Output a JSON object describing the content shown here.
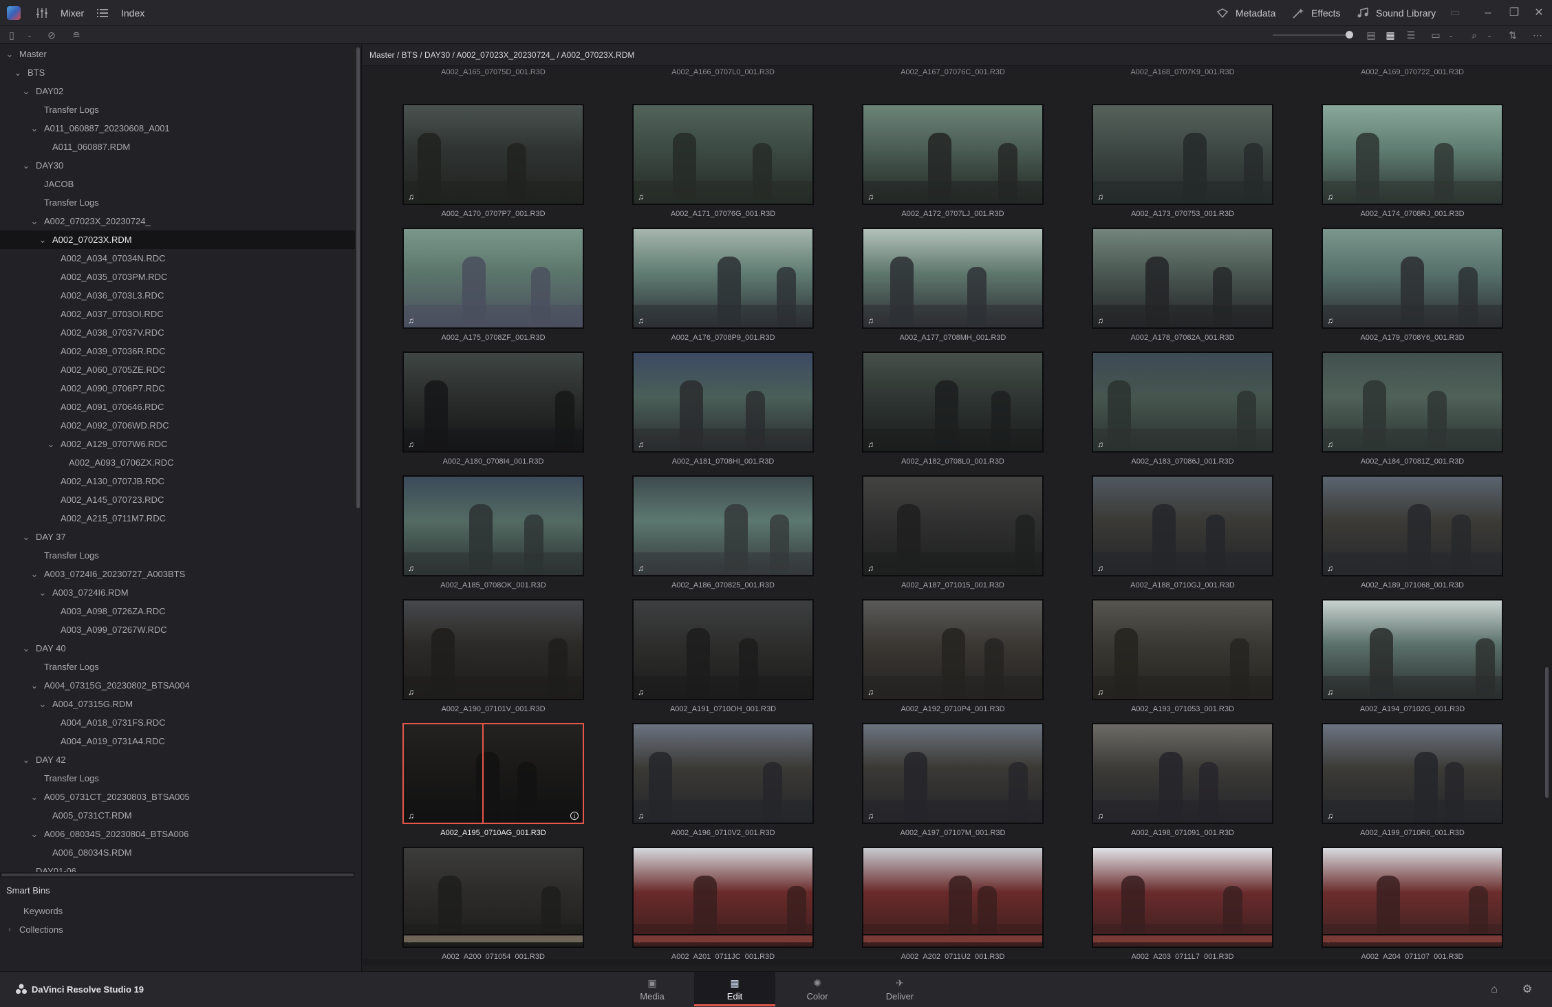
{
  "app": {
    "top_items": [
      {
        "icon": "mixer-icon",
        "label": "Mixer"
      },
      {
        "icon": "index-icon",
        "label": "Index"
      }
    ],
    "right_items": [
      {
        "icon": "metadata-icon",
        "label": "Metadata"
      },
      {
        "icon": "effects-icon",
        "label": "Effects"
      },
      {
        "icon": "sound-library-icon",
        "label": "Sound Library"
      }
    ]
  },
  "breadcrumb": "Master / BTS / DAY30 / A002_07023X_20230724_ / A002_07023X.RDM",
  "tree": [
    {
      "label": "Master",
      "depth": 0,
      "chev": "v"
    },
    {
      "label": "BTS",
      "depth": 1,
      "chev": "v"
    },
    {
      "label": "DAY02",
      "depth": 2,
      "chev": "v"
    },
    {
      "label": "Transfer Logs",
      "depth": 3,
      "chev": ""
    },
    {
      "label": "A011_060887_20230608_A001",
      "depth": 3,
      "chev": "v"
    },
    {
      "label": "A011_060887.RDM",
      "depth": 4,
      "chev": ""
    },
    {
      "label": "DAY30",
      "depth": 2,
      "chev": "v"
    },
    {
      "label": "JACOB",
      "depth": 3,
      "chev": ""
    },
    {
      "label": "Transfer Logs",
      "depth": 3,
      "chev": ""
    },
    {
      "label": "A002_07023X_20230724_",
      "depth": 3,
      "chev": "v"
    },
    {
      "label": "A002_07023X.RDM",
      "depth": 4,
      "chev": "v",
      "selected": true
    },
    {
      "label": "A002_A034_07034N.RDC",
      "depth": 5,
      "chev": ""
    },
    {
      "label": "A002_A035_0703PM.RDC",
      "depth": 5,
      "chev": ""
    },
    {
      "label": "A002_A036_0703L3.RDC",
      "depth": 5,
      "chev": ""
    },
    {
      "label": "A002_A037_0703OI.RDC",
      "depth": 5,
      "chev": ""
    },
    {
      "label": "A002_A038_07037V.RDC",
      "depth": 5,
      "chev": ""
    },
    {
      "label": "A002_A039_07036R.RDC",
      "depth": 5,
      "chev": ""
    },
    {
      "label": "A002_A060_0705ZE.RDC",
      "depth": 5,
      "chev": ""
    },
    {
      "label": "A002_A090_0706P7.RDC",
      "depth": 5,
      "chev": ""
    },
    {
      "label": "A002_A091_070646.RDC",
      "depth": 5,
      "chev": ""
    },
    {
      "label": "A002_A092_0706WD.RDC",
      "depth": 5,
      "chev": ""
    },
    {
      "label": "A002_A129_0707W6.RDC",
      "depth": 5,
      "chev": "v"
    },
    {
      "label": "A002_A093_0706ZX.RDC",
      "depth": 6,
      "chev": ""
    },
    {
      "label": "A002_A130_0707JB.RDC",
      "depth": 5,
      "chev": ""
    },
    {
      "label": "A002_A145_070723.RDC",
      "depth": 5,
      "chev": ""
    },
    {
      "label": "A002_A215_0711M7.RDC",
      "depth": 5,
      "chev": ""
    },
    {
      "label": "DAY 37",
      "depth": 2,
      "chev": "v"
    },
    {
      "label": "Transfer Logs",
      "depth": 3,
      "chev": ""
    },
    {
      "label": "A003_0724I6_20230727_A003BTS",
      "depth": 3,
      "chev": "v"
    },
    {
      "label": "A003_0724I6.RDM",
      "depth": 4,
      "chev": "v"
    },
    {
      "label": "A003_A098_0726ZA.RDC",
      "depth": 5,
      "chev": ""
    },
    {
      "label": "A003_A099_07267W.RDC",
      "depth": 5,
      "chev": ""
    },
    {
      "label": "DAY 40",
      "depth": 2,
      "chev": "v"
    },
    {
      "label": "Transfer Logs",
      "depth": 3,
      "chev": ""
    },
    {
      "label": "A004_07315G_20230802_BTSA004",
      "depth": 3,
      "chev": "v"
    },
    {
      "label": "A004_07315G.RDM",
      "depth": 4,
      "chev": "v"
    },
    {
      "label": "A004_A018_0731FS.RDC",
      "depth": 5,
      "chev": ""
    },
    {
      "label": "A004_A019_0731A4.RDC",
      "depth": 5,
      "chev": ""
    },
    {
      "label": "DAY 42",
      "depth": 2,
      "chev": "v"
    },
    {
      "label": "Transfer Logs",
      "depth": 3,
      "chev": ""
    },
    {
      "label": "A005_0731CT_20230803_BTSA005",
      "depth": 3,
      "chev": "v"
    },
    {
      "label": "A005_0731CT.RDM",
      "depth": 4,
      "chev": ""
    },
    {
      "label": "A006_08034S_20230804_BTSA006",
      "depth": 3,
      "chev": "v"
    },
    {
      "label": "A006_08034S.RDM",
      "depth": 4,
      "chev": ""
    },
    {
      "label": "DAY01-06",
      "depth": 2,
      "chev": "v"
    }
  ],
  "smart_bins": {
    "title": "Smart Bins",
    "items": [
      {
        "label": "Keywords",
        "chev": ""
      },
      {
        "label": "Collections",
        "chev": ">"
      }
    ]
  },
  "top_row_labels": [
    "A002_A165_07075D_001.R3D",
    "A002_A166_0707L0_001.R3D",
    "A002_A167_07076C_001.R3D",
    "A002_A168_0707K9_001.R3D",
    "A002_A169_070722_001.R3D"
  ],
  "clips": [
    {
      "name": "A002_A170_0707P7_001.R3D",
      "colors": [
        "#2f3432",
        "#4a5250",
        "#20221f"
      ]
    },
    {
      "name": "A002_A171_07076G_001.R3D",
      "colors": [
        "#3b4a42",
        "#51635a",
        "#262b27"
      ]
    },
    {
      "name": "A002_A172_0707LJ_001.R3D",
      "colors": [
        "#4a5c54",
        "#6c8478",
        "#232624"
      ]
    },
    {
      "name": "A002_A173_070753_001.R3D",
      "colors": [
        "#3d4743",
        "#56615c",
        "#25292a"
      ]
    },
    {
      "name": "A002_A174_0708RJ_001.R3D",
      "colors": [
        "#5f7d72",
        "#8aa79b",
        "#2e3532"
      ]
    },
    {
      "name": "A002_A175_0708ZF_001.R3D",
      "colors": [
        "#5b756b",
        "#7b978b",
        "#4a4f5e"
      ]
    },
    {
      "name": "A002_A176_0708P9_001.R3D",
      "colors": [
        "#607c72",
        "#a5b6ad",
        "#2c3034"
      ]
    },
    {
      "name": "A002_A177_0708MH_001.R3D",
      "colors": [
        "#5e776d",
        "#b3c2ba",
        "#2d3034"
      ]
    },
    {
      "name": "A002_A178_07082A_001.R3D",
      "colors": [
        "#4a5752",
        "#73857c",
        "#232527"
      ]
    },
    {
      "name": "A002_A179_0708Y6_001.R3D",
      "colors": [
        "#56706a",
        "#7b978d",
        "#2b2e31"
      ]
    },
    {
      "name": "A002_A180_0708I4_001.R3D",
      "colors": [
        "#2a2d2c",
        "#3f4644",
        "#151617"
      ]
    },
    {
      "name": "A002_A181_0708HI_001.R3D",
      "colors": [
        "#4a5f58",
        "#3c4962",
        "#2a2c2e"
      ]
    },
    {
      "name": "A002_A182_0708L0_001.R3D",
      "colors": [
        "#2e3532",
        "#46504b",
        "#1c1e1e"
      ]
    },
    {
      "name": "A002_A183_07086J_001.R3D",
      "colors": [
        "#46564f",
        "#3d4a55",
        "#2c3230"
      ]
    },
    {
      "name": "A002_A184_07081Z_001.R3D",
      "colors": [
        "#4f6159",
        "#42504e",
        "#2e3533"
      ]
    },
    {
      "name": "A002_A185_0708OK_001.R3D",
      "colors": [
        "#536b63",
        "#3b4a5a",
        "#2d3333"
      ]
    },
    {
      "name": "A002_A186_070825_001.R3D",
      "colors": [
        "#5c7870",
        "#3e4a4e",
        "#34393a"
      ]
    },
    {
      "name": "A002_A187_071015_001.R3D",
      "colors": [
        "#2f302f",
        "#434442",
        "#1e1f1f"
      ]
    },
    {
      "name": "A002_A188_0710GJ_001.R3D",
      "colors": [
        "#3a3935",
        "#505860",
        "#24262a"
      ]
    },
    {
      "name": "A002_A189_071068_001.R3D",
      "colors": [
        "#3b3a36",
        "#5a6470",
        "#26282b"
      ]
    },
    {
      "name": "A002_A190_07101V_001.R3D",
      "colors": [
        "#2c2a27",
        "#46484c",
        "#1e1d1c"
      ]
    },
    {
      "name": "A002_A191_0710OH_001.R3D",
      "colors": [
        "#2d2d2c",
        "#3d3f40",
        "#1c1c1c"
      ]
    },
    {
      "name": "A002_A192_0710P4_001.R3D",
      "colors": [
        "#3a3733",
        "#5a5a58",
        "#242320"
      ]
    },
    {
      "name": "A002_A193_071053_001.R3D",
      "colors": [
        "#3a3833",
        "#565550",
        "#24231f"
      ]
    },
    {
      "name": "A002_A194_07102G_001.R3D",
      "colors": [
        "#5a706a",
        "#c9d3d0",
        "#2a2e2d"
      ]
    },
    {
      "name": "A002_A195_0710AG_001.R3D",
      "colors": [
        "#1a1918",
        "#232221",
        "#121212"
      ],
      "selected": true
    },
    {
      "name": "A002_A196_0710V2_001.R3D",
      "colors": [
        "#3a3935",
        "#6b7380",
        "#25262a"
      ]
    },
    {
      "name": "A002_A197_07107M_001.R3D",
      "colors": [
        "#3a3833",
        "#6c7480",
        "#25252a"
      ]
    },
    {
      "name": "A002_A198_071091_001.R3D",
      "colors": [
        "#3b3a36",
        "#6d6b66",
        "#25242a"
      ]
    },
    {
      "name": "A002_A199_0710R6_001.R3D",
      "colors": [
        "#3b3a36",
        "#6c7482",
        "#25262a"
      ]
    },
    {
      "name": "A002_A200_071054_001.R3D",
      "colors": [
        "#2c2b29",
        "#3c3c3a",
        "#1d1d1c"
      ]
    },
    {
      "name": "A002_A201_0711JC_001.R3D",
      "colors": [
        "#6a2a2a",
        "#d5d8dc",
        "#3a1e1e"
      ]
    },
    {
      "name": "A002_A202_0711U2_001.R3D",
      "colors": [
        "#6a2a2a",
        "#c6cad0",
        "#3a1e1e"
      ]
    },
    {
      "name": "A002_A203_0711L7_001.R3D",
      "colors": [
        "#6a2b2c",
        "#e0e2e6",
        "#3a1f20"
      ]
    },
    {
      "name": "A002_A204_071107_001.R3D",
      "colors": [
        "#6b2d2c",
        "#d8dbe0",
        "#3b2021"
      ]
    }
  ],
  "bottom_row_colors": [
    "#6e6458",
    "#7a3a36",
    "#7a3a36",
    "#7a3a36",
    "#7a3a36"
  ],
  "product": "DaVinci Resolve Studio 19",
  "pages": [
    {
      "label": "Media",
      "icon": "media-page-icon"
    },
    {
      "label": "Edit",
      "icon": "edit-page-icon",
      "active": true
    },
    {
      "label": "Color",
      "icon": "color-page-icon"
    },
    {
      "label": "Deliver",
      "icon": "deliver-page-icon"
    }
  ],
  "accent": "#e4574a"
}
